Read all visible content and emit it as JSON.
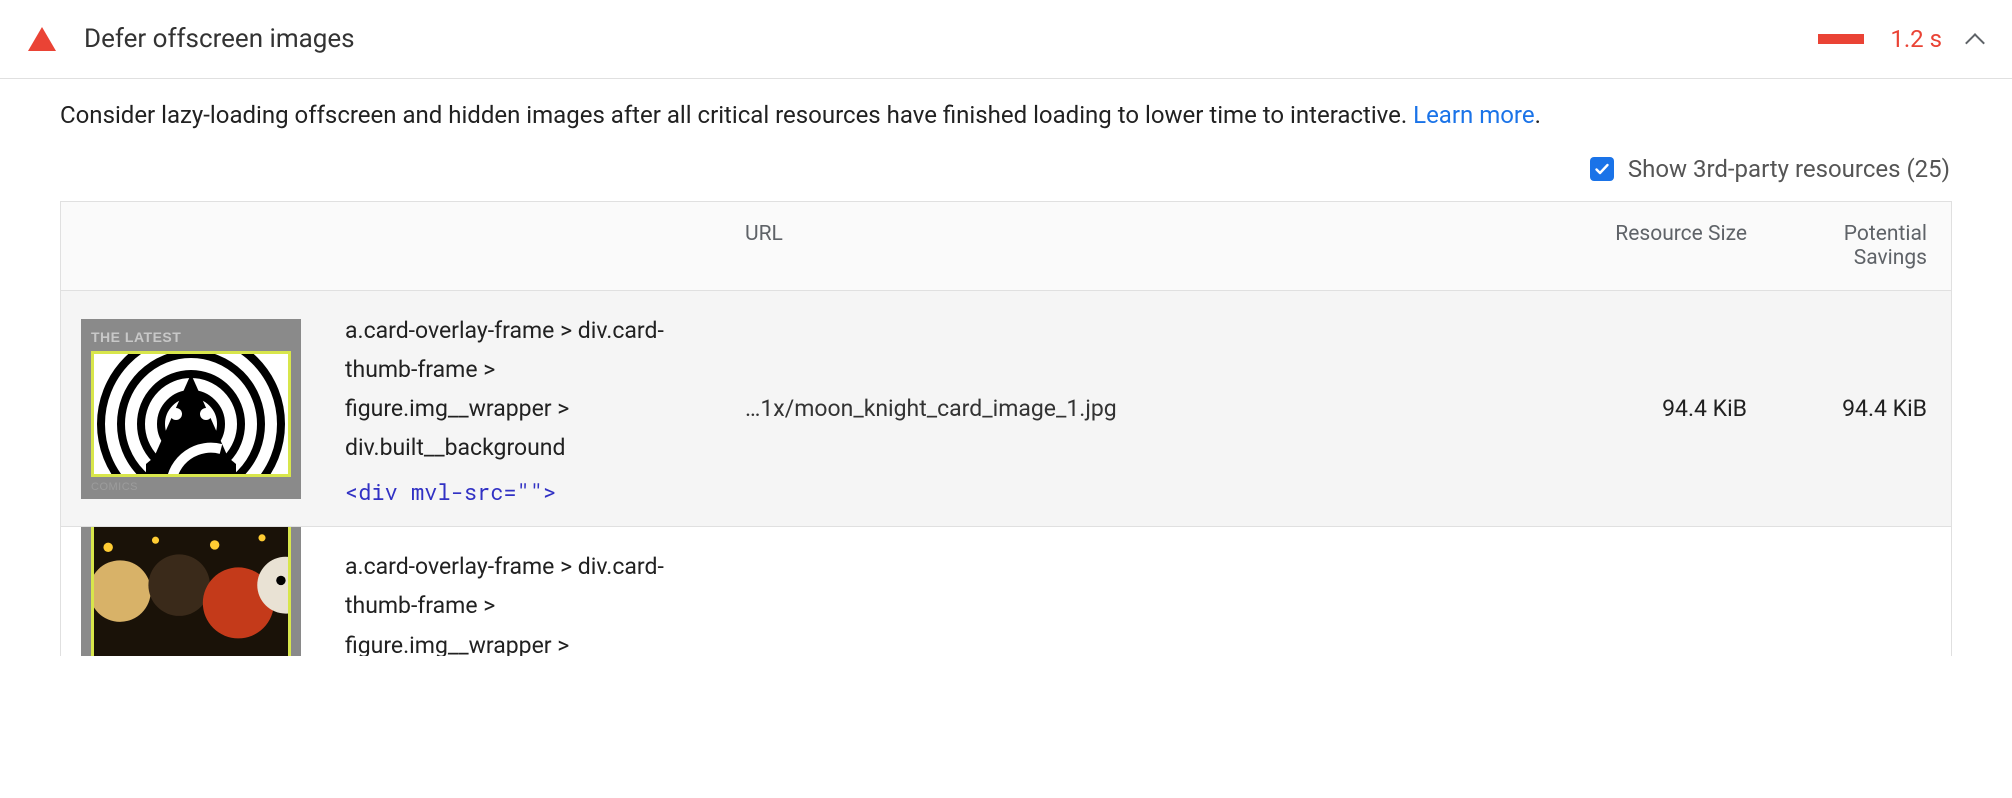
{
  "header": {
    "title": "Defer offscreen images",
    "time": "1.2 s"
  },
  "description": "Consider lazy-loading offscreen and hidden images after all critical resources have finished loading to lower time to interactive. ",
  "learn_more": "Learn more",
  "third_party": {
    "label": "Show 3rd-party resources (25)"
  },
  "columns": {
    "url": "URL",
    "resource_size": "Resource Size",
    "potential_savings": "Potential Savings"
  },
  "rows": [
    {
      "thumb_label": "THE LATEST",
      "thumb_footer": "COMICS",
      "selector": "a.card-overlay-frame > div.card-thumb-frame > figure.img__wrapper > div.built__background",
      "snippet": "<div mvl-src=\"\">",
      "url": "…1x/moon_knight_card_image_1.jpg",
      "resource_size": "94.4 KiB",
      "potential_savings": "94.4 KiB"
    },
    {
      "thumb_label": "",
      "thumb_footer": "",
      "selector": "a.card-overlay-frame > div.card-thumb-frame > figure.img__wrapper > div.built__background",
      "snippet": "",
      "url": "",
      "resource_size": "",
      "potential_savings": ""
    }
  ]
}
